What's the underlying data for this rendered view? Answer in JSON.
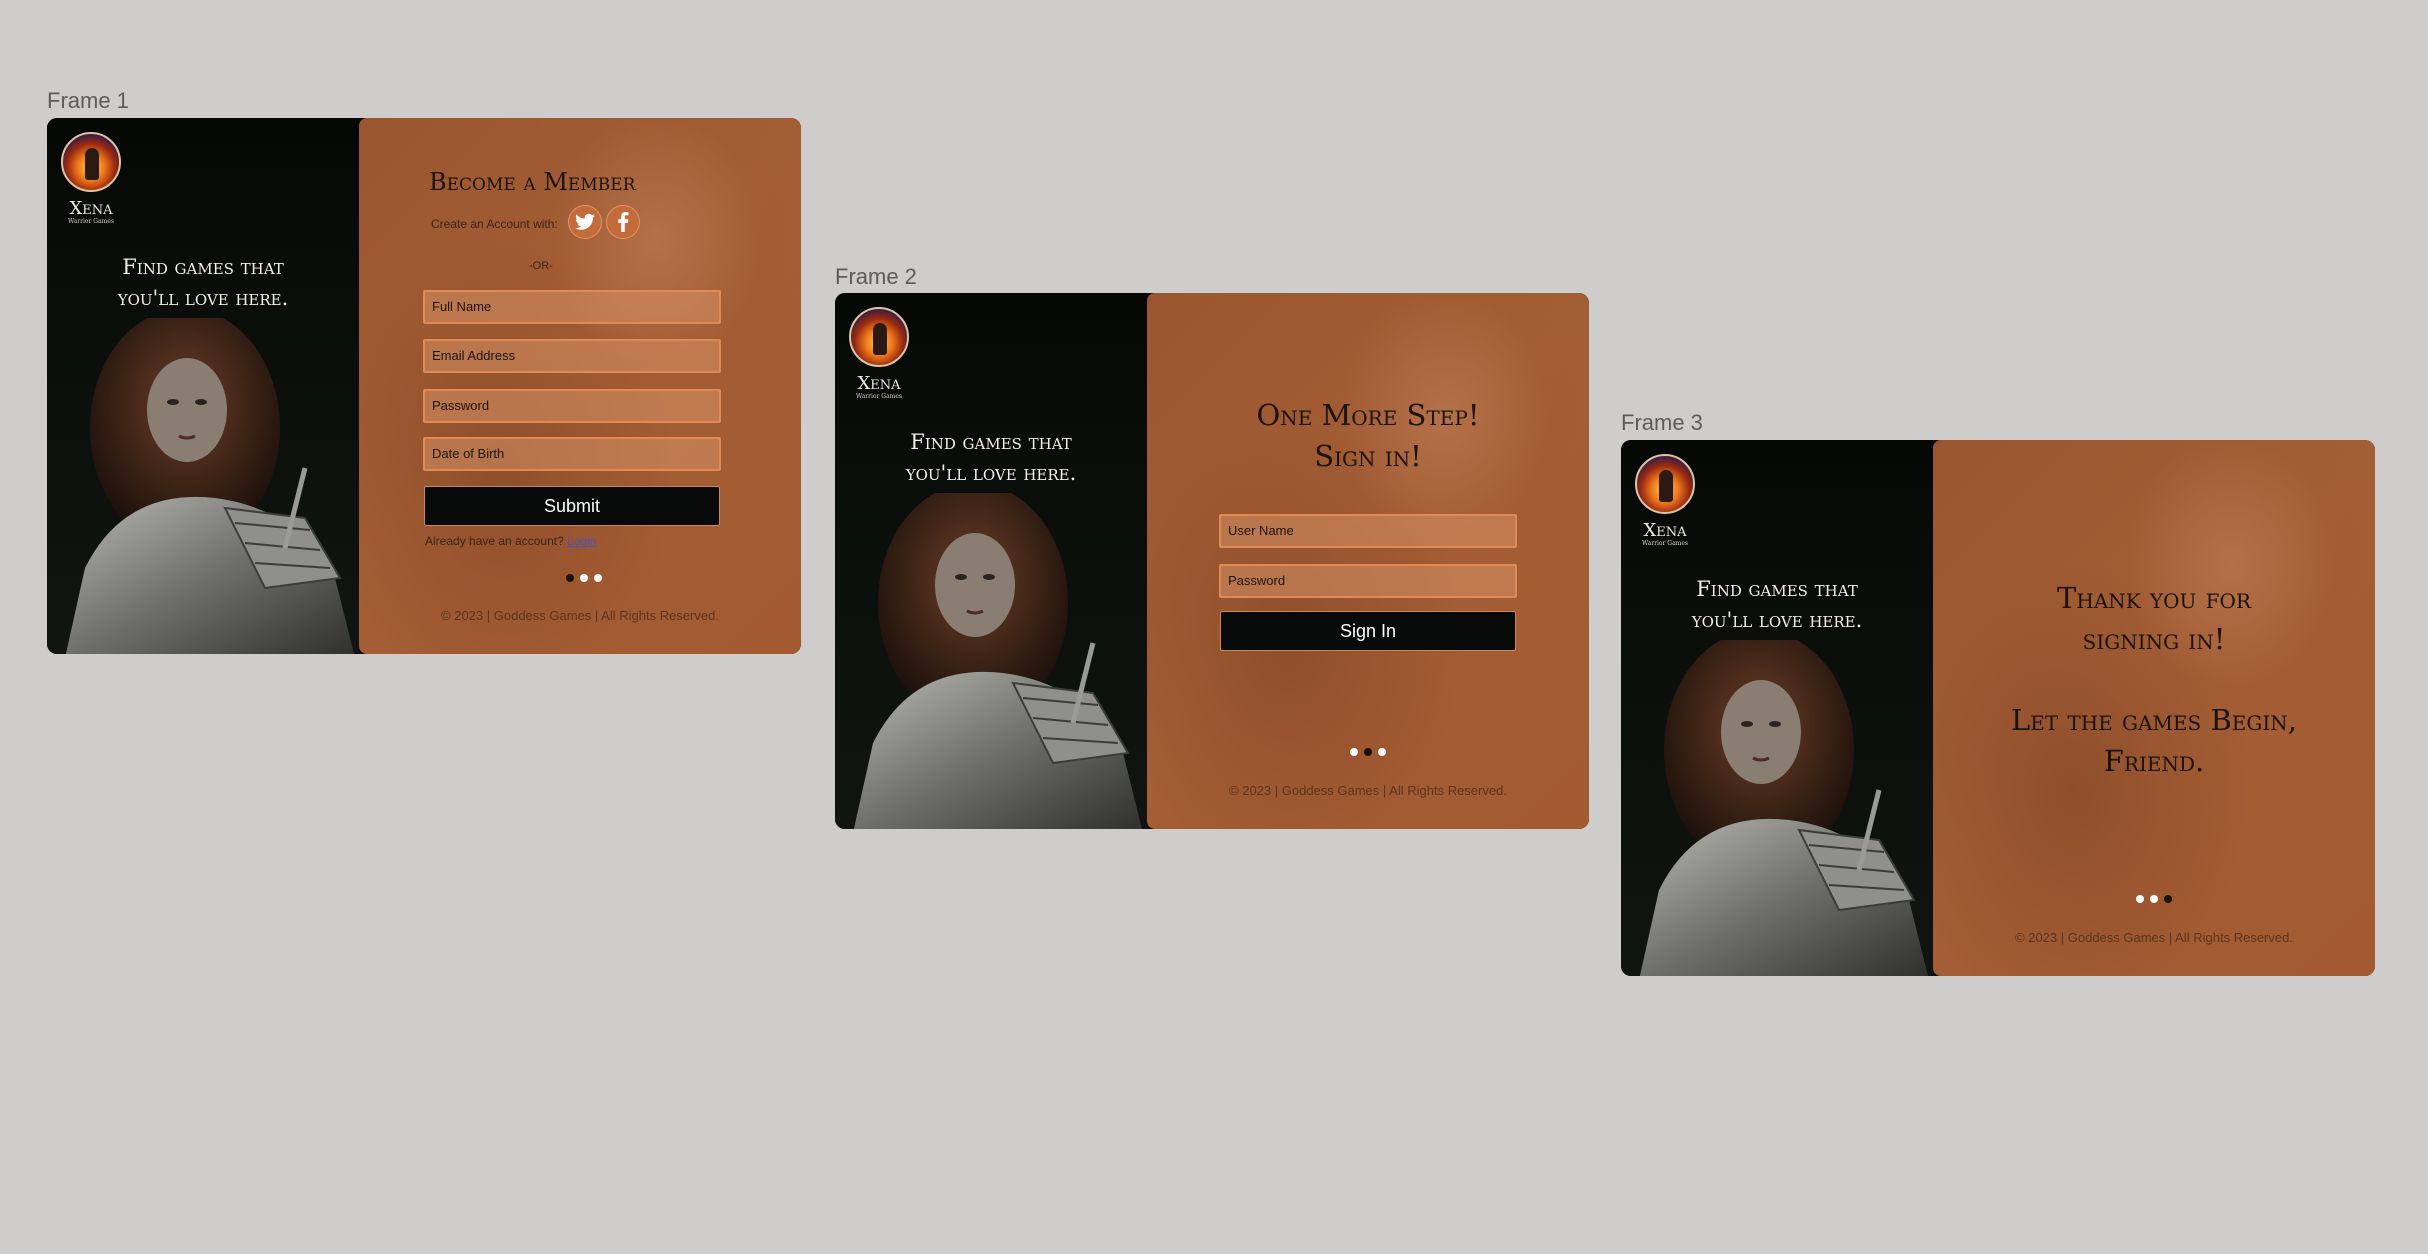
{
  "colors": {
    "canvas": "#cfcdcb",
    "panel_dark": "#0b0d0b",
    "panel_copper": "#a35a31",
    "field_border": "#e28a55",
    "button_bg": "#070a08"
  },
  "brand": {
    "name": "Xena",
    "sub": "Warrior Games",
    "tagline_line1": "Find games that",
    "tagline_line2": "you'll love here."
  },
  "frames": [
    {
      "label": "Frame 1",
      "heading": "Become a Member",
      "create_label": "Create an Account with:",
      "social": [
        {
          "icon": "twitter-icon"
        },
        {
          "icon": "facebook-icon"
        }
      ],
      "or_text": "-OR-",
      "fields": [
        {
          "placeholder": "Full Name"
        },
        {
          "placeholder": "Email Address"
        },
        {
          "placeholder": "Password"
        },
        {
          "placeholder": "Date of Birth"
        }
      ],
      "button": "Submit",
      "already_text": "Already have an account?",
      "login_link": "Login",
      "active_step": 1,
      "footer": "© 2023  | Goddess Games  |  All Rights Reserved."
    },
    {
      "label": "Frame 2",
      "heading_line1": "One More Step!",
      "heading_line2": "Sign in!",
      "fields": [
        {
          "placeholder": "User Name"
        },
        {
          "placeholder": "Password"
        }
      ],
      "button": "Sign In",
      "active_step": 2,
      "footer": "© 2023  | Goddess Games  |  All Rights Reserved."
    },
    {
      "label": "Frame 3",
      "heading_line1": "Thank you for",
      "heading_line2": "signing in!",
      "heading_line3": "Let the games Begin,",
      "heading_line4": "Friend.",
      "active_step": 3,
      "footer": "© 2023  | Goddess Games  |  All Rights Reserved."
    }
  ]
}
